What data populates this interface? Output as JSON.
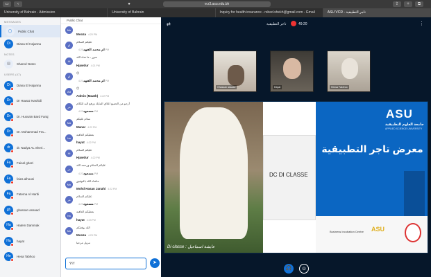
{
  "browser": {
    "tabs": [
      "University of Bahrain - Admission",
      "University of Bahrain",
      "Inquiry for health insurance - rsbed.shekh@gmail.com - Gmail",
      "ASU VCR - تاجر التطبيقية"
    ],
    "url": "vcr3.asu.edu.bh"
  },
  "users_panel": {
    "messages_title": "MESSAGES",
    "public_chat": "Public Chat",
    "private_user": "Diana El Hajanna",
    "notes_title": "NOTES",
    "shared_notes": "Shared Notes",
    "users_title": "USERS (47)",
    "users": [
      {
        "initials": "Di",
        "name": "Diana El Hajanna"
      },
      {
        "initials": "Dr",
        "name": "Dr Hawaz Nashidi"
      },
      {
        "initials": "Dr",
        "name": "Dr. Hussain Bard Faraj"
      },
      {
        "initials": "Dr",
        "name": "Dr. Mohammad Fra..."
      },
      {
        "initials": "dr",
        "name": "dr. Nadya AL Sheri..."
      },
      {
        "initials": "Fa",
        "name": "Faisal ghazi"
      },
      {
        "initials": "Fa",
        "name": "faiza alhouni"
      },
      {
        "initials": "Fa",
        "name": "Fatema Al Harbi"
      },
      {
        "initials": "gh",
        "name": "ghassan assaad"
      },
      {
        "initials": "Ha",
        "name": "Hatem Dammak"
      },
      {
        "initials": "Ha",
        "name": "hayat"
      },
      {
        "initials": "He",
        "name": "Hesa Tabhoo"
      }
    ]
  },
  "chat": {
    "header": "Public Chat",
    "messages": [
      {
        "initials": "Mo",
        "name": "Mooza",
        "time": "4:20 PM",
        "text": "عليكم السلام"
      },
      {
        "initials": "ام",
        "name": "ام محمد القهد",
        "time": "4:20 PM",
        "text": "منور ، ما شاء الله"
      },
      {
        "initials": "Hi",
        "name": "Hjawdur",
        "time": "4:21 PM",
        "text": "😊"
      },
      {
        "initials": "ام",
        "name": "ام محمد القهد",
        "time": "4:21 PM",
        "text": "😊"
      },
      {
        "initials": "Ad",
        "name": "Admin (Maath)",
        "time": "4:22 PM",
        "text": "أرجو من الجميع اغلاق المايك ورفع اليد للكلام"
      },
      {
        "initials": "مر",
        "name": "مسعود",
        "time": "4:22 PM",
        "text": "سلام عليكم"
      },
      {
        "initials": "Ma",
        "name": "Manar",
        "time": "4:22 PM",
        "text": "بعطيكم العافية"
      },
      {
        "initials": "ha",
        "name": "hayat",
        "time": "4:22 PM",
        "text": "عليكم السلام"
      },
      {
        "initials": "Hi",
        "name": "Hjawdur",
        "time": "4:22 PM",
        "text": "عليكم السلام ورحمة الله"
      },
      {
        "initials": "مر",
        "name": "مسعود",
        "time": "4:22 PM",
        "text": "ماشاء الله بالتوفيق"
      },
      {
        "initials": "Mo",
        "name": "Mohd Hasan Janahi",
        "time": "4:22 PM",
        "text": "عليكم السلام"
      },
      {
        "initials": "مر",
        "name": "مسعود",
        "time": "4:23 PM",
        "text": "بعطيكم العافية"
      },
      {
        "initials": "ha",
        "name": "hayat",
        "time": "4:23 PM",
        "text": "الله يوفقكم"
      },
      {
        "initials": "Mo",
        "name": "Mooza",
        "time": "4:23 PM",
        "text": "تنزيل مرحبا"
      }
    ],
    "input_value": "؟؟؟"
  },
  "main": {
    "title": "تاجر التطبيقية",
    "timer": "49:20",
    "cams": [
      {
        "name": "Ghassan assaad"
      },
      {
        "name": "Hayat"
      },
      {
        "name": "Hessa Fakhroo"
      }
    ],
    "slide": {
      "brand": "ASU",
      "brand_ar": "جامعة العلوم التطبيقية",
      "brand_en": "APPLIED SCIENCE UNIVERSITY",
      "expo_title": "معرض تاجر التطبيقية",
      "logo_text": "DC DI CLASSE",
      "caption": "Di classe : عايشة اسماعيل",
      "partner1": "Business Incubation Centre",
      "partner2": "ASU"
    }
  }
}
